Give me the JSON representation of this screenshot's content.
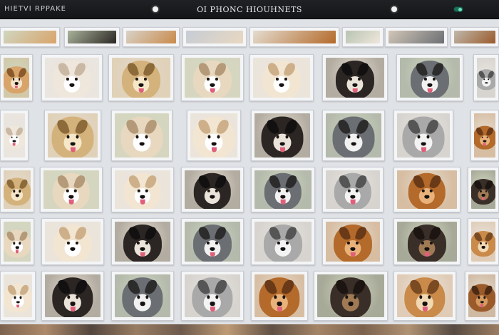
{
  "header": {
    "left_title": "HIETVI RPPAKE",
    "center_title": "OI PHONC HIOUHNETS"
  },
  "icons": {
    "status_dot_left": "status-dot",
    "status_dot_right": "status-dot",
    "toggle": "toggle-switch"
  },
  "grid": {
    "item_kind": "dog photo thumbnail",
    "rows": 5,
    "top_strip_count": 8
  }
}
